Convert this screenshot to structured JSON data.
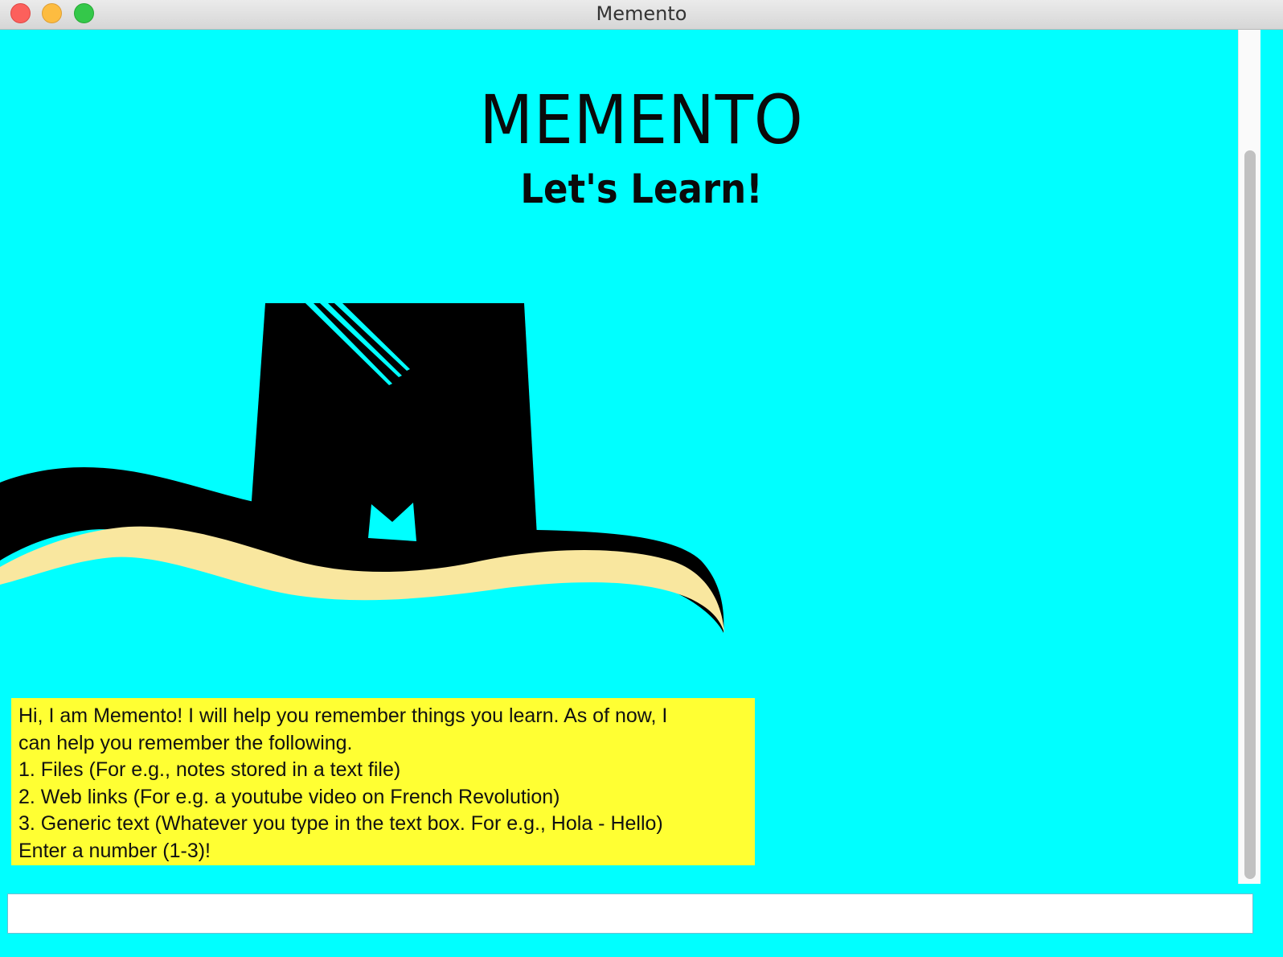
{
  "window": {
    "title": "Memento"
  },
  "header": {
    "title": "MEMENTO",
    "subtitle": "Let's Learn!"
  },
  "chat": {
    "messages": [
      {
        "lines": [
          "Hi, I am Memento! I will help you remember things you learn. As of now, I",
          "can help you remember the following.",
          "1. Files (For e.g., notes stored in a text file)",
          "2. Web links (For e.g. a youtube video on French Revolution)",
          "3. Generic text (Whatever you type in the text box. For e.g., Hola - Hello)",
          "Enter a number (1-3)!"
        ]
      }
    ]
  },
  "input": {
    "value": "",
    "placeholder": ""
  },
  "colors": {
    "background": "#00ffff",
    "message_bubble": "#ffff33",
    "hat": "#000000",
    "hat_band": "#f9e79f"
  },
  "icons": {
    "logo": "memento-hat-logo"
  }
}
